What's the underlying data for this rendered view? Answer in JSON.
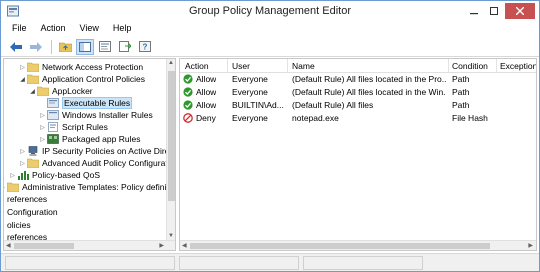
{
  "window": {
    "title": "Group Policy Management Editor"
  },
  "menu": {
    "items": [
      "File",
      "Action",
      "View",
      "Help"
    ]
  },
  "toolbar": {
    "buttons": [
      "back-arrow-icon",
      "forward-arrow-icon",
      "up-folder-icon",
      "show-hide-tree-icon",
      "properties-icon",
      "export-list-icon",
      "help-icon"
    ]
  },
  "tree": {
    "items": [
      {
        "label": "Network Access Protection",
        "expander": "▷"
      },
      {
        "label": "Application Control Policies",
        "expander": "◢"
      },
      {
        "label": "AppLocker",
        "expander": "◢"
      },
      {
        "label": "Executable Rules",
        "expander": ""
      },
      {
        "label": "Windows Installer Rules",
        "expander": "▷"
      },
      {
        "label": "Script Rules",
        "expander": "▷"
      },
      {
        "label": "Packaged app Rules",
        "expander": "▷"
      },
      {
        "label": "IP Security Policies on Active Direct",
        "expander": "▷"
      },
      {
        "label": "Advanced Audit Policy Configurati",
        "expander": "▷"
      },
      {
        "label": "Policy-based QoS",
        "expander": "▷"
      },
      {
        "label": "Administrative Templates: Policy definitio",
        "expander": "▷"
      },
      {
        "label": "references",
        "expander": ""
      },
      {
        "label": "Configuration",
        "expander": ""
      },
      {
        "label": "olicies",
        "expander": ""
      },
      {
        "label": "references",
        "expander": ""
      }
    ]
  },
  "list": {
    "columns": [
      "Action",
      "User",
      "Name",
      "Condition",
      "Exception"
    ],
    "rows": [
      {
        "action": "Allow",
        "status": "allow",
        "user": "Everyone",
        "name": "(Default Rule) All files located in the Pro...",
        "condition": "Path",
        "exception": ""
      },
      {
        "action": "Allow",
        "status": "allow",
        "user": "Everyone",
        "name": "(Default Rule) All files located in the Win...",
        "condition": "Path",
        "exception": ""
      },
      {
        "action": "Allow",
        "status": "allow",
        "user": "BUILTIN\\Ad...",
        "name": "(Default Rule) All files",
        "condition": "Path",
        "exception": ""
      },
      {
        "action": "Deny",
        "status": "deny",
        "user": "Everyone",
        "name": "notepad.exe",
        "condition": "File Hash",
        "exception": ""
      }
    ]
  },
  "colors": {
    "allow": "#2e9a2e",
    "deny": "#d42a2a",
    "selection": "#cce4f7",
    "close_button": "#c75050",
    "window_border": "#6b9bd1"
  }
}
